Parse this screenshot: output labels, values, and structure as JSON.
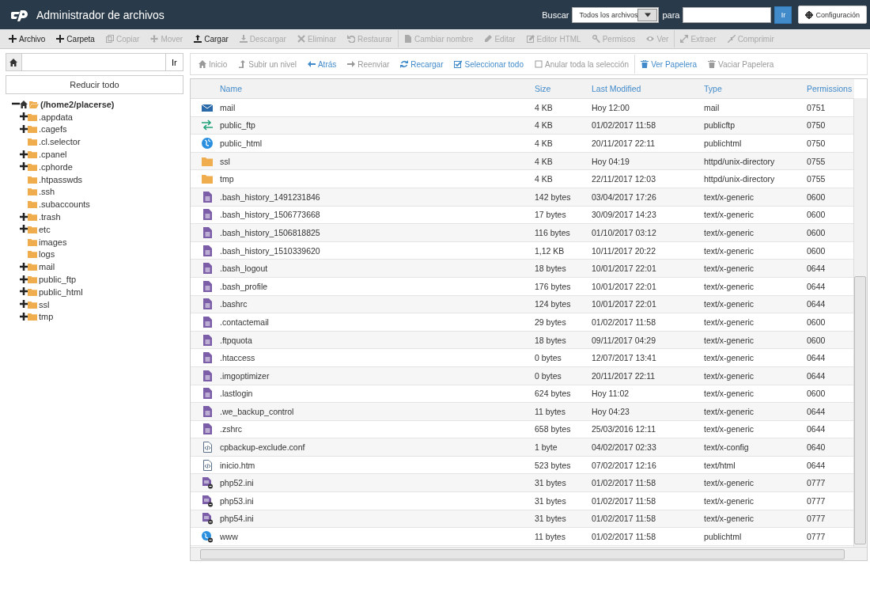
{
  "header": {
    "title": "Administrador de archivos",
    "search_label": "Buscar",
    "search_scope": "Todos los archivos",
    "for_label": "para",
    "go": "Ir",
    "settings": "Configuración"
  },
  "toolbar": [
    {
      "label": "Archivo",
      "disabled": false
    },
    {
      "label": "Carpeta",
      "disabled": false
    },
    {
      "label": "Copiar",
      "disabled": true
    },
    {
      "label": "Mover",
      "disabled": true
    },
    {
      "label": "Cargar",
      "disabled": false
    },
    {
      "label": "Descargar",
      "disabled": true
    },
    {
      "label": "Eliminar",
      "disabled": true
    },
    {
      "label": "Restaurar",
      "disabled": true
    },
    {
      "label": "Cambiar nombre",
      "disabled": true
    },
    {
      "label": "Editar",
      "disabled": true
    },
    {
      "label": "Editor HTML",
      "disabled": true
    },
    {
      "label": "Permisos",
      "disabled": true
    },
    {
      "label": "Ver",
      "disabled": true
    },
    {
      "label": "Extraer",
      "disabled": true
    },
    {
      "label": "Comprimir",
      "disabled": true
    }
  ],
  "left": {
    "go": "Ir",
    "collapse": "Reducir todo",
    "tree": {
      "label": "(/home2/placerse)",
      "kind": "branch",
      "expanded": true,
      "children": [
        {
          "label": ".appdata",
          "kind": "branch",
          "expanded": false
        },
        {
          "label": ".cagefs",
          "kind": "branch",
          "expanded": false
        },
        {
          "label": ".cl.selector",
          "kind": "leaf",
          "expanded": false
        },
        {
          "label": ".cpanel",
          "kind": "branch",
          "expanded": false
        },
        {
          "label": ".cphorde",
          "kind": "branch",
          "expanded": false
        },
        {
          "label": ".htpasswds",
          "kind": "leaf",
          "expanded": false
        },
        {
          "label": ".ssh",
          "kind": "leaf",
          "expanded": false
        },
        {
          "label": ".subaccounts",
          "kind": "leaf",
          "expanded": false
        },
        {
          "label": ".trash",
          "kind": "branch",
          "expanded": false
        },
        {
          "label": "etc",
          "kind": "branch",
          "expanded": false
        },
        {
          "label": "images",
          "kind": "leaf",
          "expanded": false
        },
        {
          "label": "logs",
          "kind": "leaf",
          "expanded": false
        },
        {
          "label": "mail",
          "kind": "branch",
          "expanded": false
        },
        {
          "label": "public_ftp",
          "kind": "branch",
          "expanded": false
        },
        {
          "label": "public_html",
          "kind": "branch",
          "expanded": false
        },
        {
          "label": "ssl",
          "kind": "branch",
          "expanded": false
        },
        {
          "label": "tmp",
          "kind": "branch",
          "expanded": false
        }
      ]
    }
  },
  "nav": [
    {
      "label": "Inicio",
      "disabled": true
    },
    {
      "label": "Subir un nivel",
      "disabled": true
    },
    {
      "label": "Atrás",
      "disabled": false
    },
    {
      "label": "Reenviar",
      "disabled": true
    },
    {
      "label": "Recargar",
      "disabled": false
    },
    {
      "label": "Seleccionar todo",
      "disabled": false
    },
    {
      "label": "Anular toda la selección",
      "disabled": true
    },
    {
      "label": "Ver Papelera",
      "disabled": false
    },
    {
      "label": "Vaciar Papelera",
      "disabled": true
    }
  ],
  "table": {
    "columns": [
      "Name",
      "Size",
      "Last Modified",
      "Type",
      "Permissions"
    ],
    "rows": [
      {
        "kind": "mail",
        "name": "mail",
        "size": "4 KB",
        "modified": "Hoy 12:00",
        "type": "mail",
        "perms": "0751"
      },
      {
        "kind": "ftp",
        "name": "public_ftp",
        "size": "4 KB",
        "modified": "01/02/2017 11:58",
        "type": "publicftp",
        "perms": "0750"
      },
      {
        "kind": "web",
        "name": "public_html",
        "size": "4 KB",
        "modified": "20/11/2017 22:11",
        "type": "publichtml",
        "perms": "0750"
      },
      {
        "kind": "folder",
        "name": "ssl",
        "size": "4 KB",
        "modified": "Hoy 04:19",
        "type": "httpd/unix-directory",
        "perms": "0755"
      },
      {
        "kind": "folder",
        "name": "tmp",
        "size": "4 KB",
        "modified": "22/11/2017 12:03",
        "type": "httpd/unix-directory",
        "perms": "0755"
      },
      {
        "kind": "text",
        "name": ".bash_history_1491231846",
        "size": "142 bytes",
        "modified": "03/04/2017 17:26",
        "type": "text/x-generic",
        "perms": "0600"
      },
      {
        "kind": "text",
        "name": ".bash_history_1506773668",
        "size": "17 bytes",
        "modified": "30/09/2017 14:23",
        "type": "text/x-generic",
        "perms": "0600"
      },
      {
        "kind": "text",
        "name": ".bash_history_1506818825",
        "size": "116 bytes",
        "modified": "01/10/2017 03:12",
        "type": "text/x-generic",
        "perms": "0600"
      },
      {
        "kind": "text",
        "name": ".bash_history_1510339620",
        "size": "1,12 KB",
        "modified": "10/11/2017 20:22",
        "type": "text/x-generic",
        "perms": "0600"
      },
      {
        "kind": "text",
        "name": ".bash_logout",
        "size": "18 bytes",
        "modified": "10/01/2017 22:01",
        "type": "text/x-generic",
        "perms": "0644"
      },
      {
        "kind": "text",
        "name": ".bash_profile",
        "size": "176 bytes",
        "modified": "10/01/2017 22:01",
        "type": "text/x-generic",
        "perms": "0644"
      },
      {
        "kind": "text",
        "name": ".bashrc",
        "size": "124 bytes",
        "modified": "10/01/2017 22:01",
        "type": "text/x-generic",
        "perms": "0644"
      },
      {
        "kind": "text",
        "name": ".contactemail",
        "size": "29 bytes",
        "modified": "01/02/2017 11:58",
        "type": "text/x-generic",
        "perms": "0600"
      },
      {
        "kind": "text",
        "name": ".ftpquota",
        "size": "18 bytes",
        "modified": "09/11/2017 04:29",
        "type": "text/x-generic",
        "perms": "0600"
      },
      {
        "kind": "text",
        "name": ".htaccess",
        "size": "0 bytes",
        "modified": "12/07/2017 13:41",
        "type": "text/x-generic",
        "perms": "0644"
      },
      {
        "kind": "text",
        "name": ".imgoptimizer",
        "size": "0 bytes",
        "modified": "20/11/2017 22:11",
        "type": "text/x-generic",
        "perms": "0644"
      },
      {
        "kind": "text",
        "name": ".lastlogin",
        "size": "624 bytes",
        "modified": "Hoy 11:02",
        "type": "text/x-generic",
        "perms": "0600"
      },
      {
        "kind": "text",
        "name": ".we_backup_control",
        "size": "11 bytes",
        "modified": "Hoy 04:23",
        "type": "text/x-generic",
        "perms": "0644"
      },
      {
        "kind": "text",
        "name": ".zshrc",
        "size": "658 bytes",
        "modified": "25/03/2016 12:11",
        "type": "text/x-generic",
        "perms": "0644"
      },
      {
        "kind": "code",
        "name": "cpbackup-exclude.conf",
        "size": "1 byte",
        "modified": "04/02/2017 02:33",
        "type": "text/x-config",
        "perms": "0640"
      },
      {
        "kind": "code",
        "name": "inicio.htm",
        "size": "523 bytes",
        "modified": "07/02/2017 12:16",
        "type": "text/html",
        "perms": "0644"
      },
      {
        "kind": "link",
        "name": "php52.ini",
        "size": "31 bytes",
        "modified": "01/02/2017 11:58",
        "type": "text/x-generic",
        "perms": "0777"
      },
      {
        "kind": "link",
        "name": "php53.ini",
        "size": "31 bytes",
        "modified": "01/02/2017 11:58",
        "type": "text/x-generic",
        "perms": "0777"
      },
      {
        "kind": "link",
        "name": "php54.ini",
        "size": "31 bytes",
        "modified": "01/02/2017 11:58",
        "type": "text/x-generic",
        "perms": "0777"
      },
      {
        "kind": "weblink",
        "name": "www",
        "size": "11 bytes",
        "modified": "01/02/2017 11:58",
        "type": "publichtml",
        "perms": "0777"
      }
    ]
  }
}
